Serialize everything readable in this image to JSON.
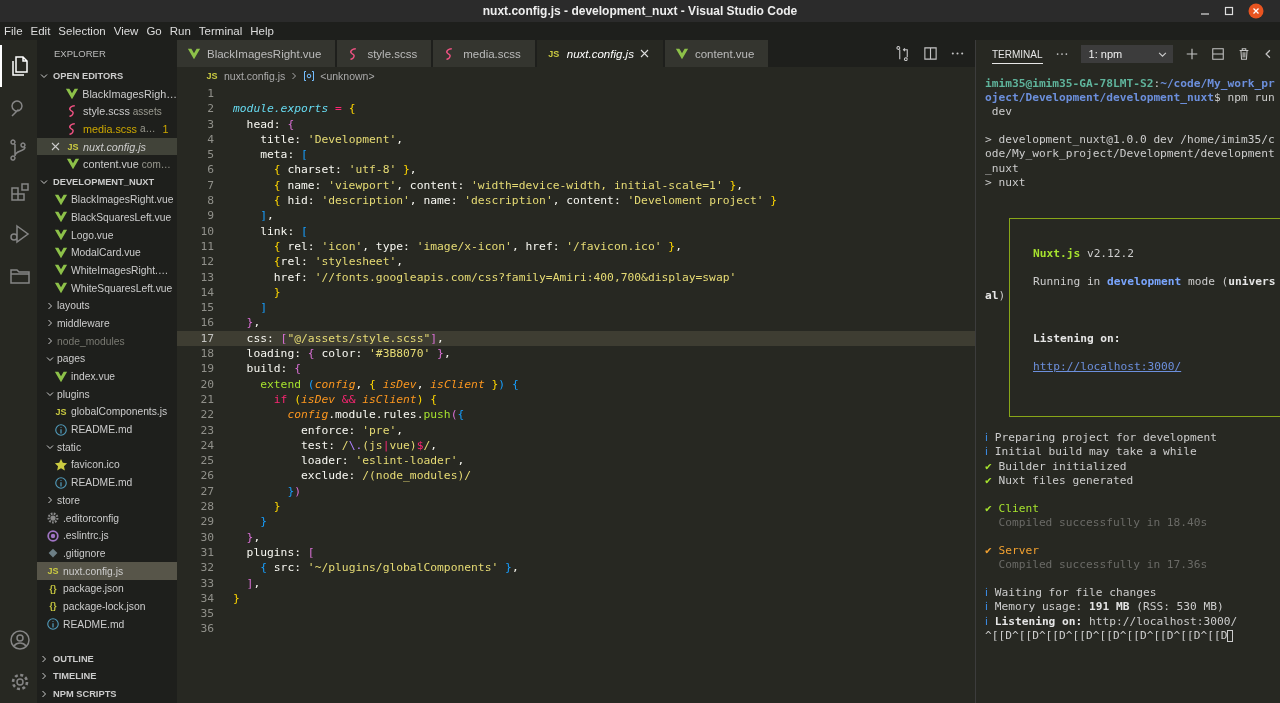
{
  "window": {
    "title": "nuxt.config.js - development_nuxt - Visual Studio Code"
  },
  "menu": [
    "File",
    "Edit",
    "Selection",
    "View",
    "Go",
    "Run",
    "Terminal",
    "Help"
  ],
  "activity_bar": [
    {
      "kind": "files",
      "selected": true
    },
    {
      "kind": "search",
      "selected": false
    },
    {
      "kind": "branch",
      "selected": false
    },
    {
      "kind": "blocks",
      "selected": false
    },
    {
      "kind": "run",
      "selected": false
    },
    {
      "kind": "folder",
      "selected": false
    }
  ],
  "activity_bar_bottom": [
    {
      "kind": "account"
    },
    {
      "kind": "settings"
    }
  ],
  "explorer": {
    "title": "EXPLORER",
    "open_editors": {
      "label": "OPEN EDITORS",
      "expanded": true,
      "items": [
        {
          "name": "BlackImagesRigh…",
          "kind": "vue",
          "selected": false,
          "warning": false,
          "preview": false
        },
        {
          "name": "style.scss",
          "description": "assets",
          "kind": "scss",
          "selected": false,
          "warning": false,
          "preview": false
        },
        {
          "name": "media.scss",
          "description": "a…",
          "badge": "1",
          "kind": "scss",
          "selected": false,
          "warning": true,
          "preview": false
        },
        {
          "name": "nuxt.config.js",
          "kind": "glyph",
          "glyph": "JS",
          "selected": true,
          "warning": false,
          "preview": true
        },
        {
          "name": "content.vue",
          "description": "com…",
          "kind": "vue",
          "selected": false,
          "warning": false,
          "preview": false
        }
      ]
    },
    "project": {
      "label": "DEVELOPMENT_NUXT",
      "expanded": true,
      "tree": [
        {
          "kind": "group",
          "children": [
            {
              "kind": "vue",
              "name": "BlackImagesRight.vue",
              "selected": false,
              "ignored": false
            },
            {
              "kind": "vue",
              "name": "BlackSquaresLeft.vue",
              "selected": false,
              "ignored": false
            },
            {
              "kind": "vue",
              "name": "Logo.vue",
              "selected": false,
              "ignored": false
            },
            {
              "kind": "vue",
              "name": "ModalCard.vue",
              "selected": false,
              "ignored": false
            },
            {
              "kind": "vue",
              "name": "WhiteImagesRight.…",
              "selected": false,
              "ignored": false
            },
            {
              "kind": "vue",
              "name": "WhiteSquaresLeft.vue",
              "selected": false,
              "ignored": false
            }
          ]
        },
        {
          "kind": "folder",
          "name": "layouts",
          "expanded": false,
          "selected": false,
          "ignored": false
        },
        {
          "kind": "folder",
          "name": "middleware",
          "expanded": false,
          "selected": false,
          "ignored": false
        },
        {
          "kind": "folder",
          "name": "node_modules",
          "expanded": false,
          "selected": false,
          "ignored": true
        },
        {
          "kind": "folder",
          "name": "pages",
          "expanded": true,
          "selected": false,
          "ignored": false,
          "children": [
            {
              "kind": "vue",
              "name": "index.vue",
              "selected": false,
              "ignored": false
            }
          ]
        },
        {
          "kind": "folder",
          "name": "plugins",
          "expanded": true,
          "selected": false,
          "ignored": false,
          "children": [
            {
              "kind": "glyph",
              "glyph": "JS",
              "name": "globalComponents.js",
              "selected": false,
              "ignored": false
            },
            {
              "kind": "info",
              "name": "README.md",
              "selected": false,
              "ignored": false
            }
          ]
        },
        {
          "kind": "folder",
          "name": "static",
          "expanded": true,
          "selected": false,
          "ignored": false,
          "children": [
            {
              "kind": "star",
              "name": "favicon.ico",
              "selected": false,
              "ignored": false
            },
            {
              "kind": "info",
              "name": "README.md",
              "selected": false,
              "ignored": false
            }
          ]
        },
        {
          "kind": "folder",
          "name": "store",
          "expanded": false,
          "selected": false,
          "ignored": false
        },
        {
          "kind": "gear",
          "name": ".editorconfig",
          "selected": false,
          "ignored": false
        },
        {
          "kind": "ring",
          "name": ".eslintrc.js",
          "selected": false,
          "ignored": false
        },
        {
          "kind": "diamond",
          "name": ".gitignore",
          "selected": false,
          "ignored": false
        },
        {
          "kind": "glyph",
          "glyph": "JS",
          "name": "nuxt.config.js",
          "selected": true,
          "ignored": false
        },
        {
          "kind": "glyph",
          "glyph": "{}",
          "name": "package.json",
          "selected": false,
          "ignored": false
        },
        {
          "kind": "glyph",
          "glyph": "{}",
          "name": "package-lock.json",
          "selected": false,
          "ignored": false
        },
        {
          "kind": "info",
          "name": "README.md",
          "selected": false,
          "ignored": false
        }
      ]
    },
    "collapsed_sections": [
      {
        "label": "OUTLINE",
        "expanded": false
      },
      {
        "label": "TIMELINE",
        "expanded": false
      },
      {
        "label": "NPM SCRIPTS",
        "expanded": false
      }
    ]
  },
  "tabs": [
    {
      "label": "BlackImagesRight.vue",
      "kind": "vue",
      "selected": false,
      "preview": false
    },
    {
      "label": "style.scss",
      "kind": "scss",
      "selected": false,
      "preview": false
    },
    {
      "label": "media.scss",
      "kind": "scss",
      "selected": false,
      "preview": false
    },
    {
      "label": "nuxt.config.js",
      "kind": "glyph",
      "glyph": "JS",
      "selected": true,
      "preview": true
    },
    {
      "label": "content.vue",
      "kind": "vue",
      "selected": false,
      "preview": false
    }
  ],
  "breadcrumb": {
    "kind": "glyph",
    "glyph": "JS",
    "file": "nuxt.config.js",
    "symbol": "<unknown>"
  },
  "editor": {
    "lines": [
      {
        "n": "1",
        "current": false
      },
      {
        "n": "2",
        "current": false,
        "tokens": [
          {
            "kind": "builtin",
            "t": "module.exports"
          },
          {
            "kind": "operator",
            "t": " = "
          },
          {
            "kind": "bracket1",
            "t": "{"
          }
        ]
      },
      {
        "n": "3",
        "current": false,
        "tokens": [
          {
            "kind": "plain",
            "t": "  head: "
          },
          {
            "kind": "bracket2",
            "t": "{"
          }
        ]
      },
      {
        "n": "4",
        "current": false,
        "tokens": [
          {
            "kind": "plain",
            "t": "    title: "
          },
          {
            "kind": "string",
            "t": "'Development'"
          },
          {
            "kind": "plain",
            "t": ","
          }
        ]
      },
      {
        "n": "5",
        "current": false,
        "tokens": [
          {
            "kind": "plain",
            "t": "    meta: "
          },
          {
            "kind": "bracket3",
            "t": "["
          }
        ]
      },
      {
        "n": "6",
        "current": false,
        "tokens": [
          {
            "kind": "bracket1",
            "t": "      {"
          },
          {
            "kind": "plain",
            "t": " charset: "
          },
          {
            "kind": "string",
            "t": "'utf-8'"
          },
          {
            "kind": "bracket1",
            "t": " }"
          },
          {
            "kind": "plain",
            "t": ","
          }
        ]
      },
      {
        "n": "7",
        "current": false,
        "tokens": [
          {
            "kind": "bracket1",
            "t": "      {"
          },
          {
            "kind": "plain",
            "t": " name: "
          },
          {
            "kind": "string",
            "t": "'viewport'"
          },
          {
            "kind": "plain",
            "t": ", content: "
          },
          {
            "kind": "string",
            "t": "'width=device-width, initial-scale=1'"
          },
          {
            "kind": "bracket1",
            "t": " }"
          },
          {
            "kind": "plain",
            "t": ","
          }
        ]
      },
      {
        "n": "8",
        "current": false,
        "tokens": [
          {
            "kind": "bracket1",
            "t": "      {"
          },
          {
            "kind": "plain",
            "t": " hid: "
          },
          {
            "kind": "string",
            "t": "'description'"
          },
          {
            "kind": "plain",
            "t": ", name: "
          },
          {
            "kind": "string",
            "t": "'description'"
          },
          {
            "kind": "plain",
            "t": ", content: "
          },
          {
            "kind": "string",
            "t": "'Develoment project'"
          },
          {
            "kind": "bracket1",
            "t": " }"
          }
        ]
      },
      {
        "n": "9",
        "current": false,
        "tokens": [
          {
            "kind": "bracket3",
            "t": "    ]"
          },
          {
            "kind": "plain",
            "t": ","
          }
        ]
      },
      {
        "n": "10",
        "current": false,
        "tokens": [
          {
            "kind": "plain",
            "t": "    link: "
          },
          {
            "kind": "bracket3",
            "t": "["
          }
        ]
      },
      {
        "n": "11",
        "current": false,
        "tokens": [
          {
            "kind": "bracket1",
            "t": "      {"
          },
          {
            "kind": "plain",
            "t": " rel: "
          },
          {
            "kind": "string",
            "t": "'icon'"
          },
          {
            "kind": "plain",
            "t": ", type: "
          },
          {
            "kind": "string",
            "t": "'image/x-icon'"
          },
          {
            "kind": "plain",
            "t": ", href: "
          },
          {
            "kind": "string",
            "t": "'/favicon.ico'"
          },
          {
            "kind": "bracket1",
            "t": " }"
          },
          {
            "kind": "plain",
            "t": ","
          }
        ]
      },
      {
        "n": "12",
        "current": false,
        "tokens": [
          {
            "kind": "bracket1",
            "t": "      {"
          },
          {
            "kind": "plain",
            "t": "rel: "
          },
          {
            "kind": "string",
            "t": "'stylesheet'"
          },
          {
            "kind": "plain",
            "t": ","
          }
        ]
      },
      {
        "n": "13",
        "current": false,
        "tokens": [
          {
            "kind": "plain",
            "t": "      href: "
          },
          {
            "kind": "string",
            "t": "'//fonts.googleapis.com/css?family=Amiri:400,700&display=swap'"
          }
        ]
      },
      {
        "n": "14",
        "current": false,
        "tokens": [
          {
            "kind": "bracket1",
            "t": "      }"
          }
        ]
      },
      {
        "n": "15",
        "current": false,
        "tokens": [
          {
            "kind": "bracket3",
            "t": "    ]"
          }
        ]
      },
      {
        "n": "16",
        "current": false,
        "tokens": [
          {
            "kind": "bracket2",
            "t": "  }"
          },
          {
            "kind": "plain",
            "t": ","
          }
        ]
      },
      {
        "n": "17",
        "current": true,
        "tokens": [
          {
            "kind": "plain",
            "t": "  css: "
          },
          {
            "kind": "bracket2",
            "t": "["
          },
          {
            "kind": "string",
            "t": "\"@/assets/style.scss\""
          },
          {
            "kind": "bracket2",
            "t": "]"
          },
          {
            "kind": "plain",
            "t": ","
          }
        ]
      },
      {
        "n": "18",
        "current": false,
        "tokens": [
          {
            "kind": "plain",
            "t": "  loading: "
          },
          {
            "kind": "bracket2",
            "t": "{"
          },
          {
            "kind": "plain",
            "t": " color: "
          },
          {
            "kind": "string",
            "t": "'#3B8070'"
          },
          {
            "kind": "bracket2",
            "t": " }"
          },
          {
            "kind": "plain",
            "t": ","
          }
        ]
      },
      {
        "n": "19",
        "current": false,
        "tokens": [
          {
            "kind": "plain",
            "t": "  build: "
          },
          {
            "kind": "bracket2",
            "t": "{"
          }
        ]
      },
      {
        "n": "20",
        "current": false,
        "tokens": [
          {
            "kind": "function",
            "t": "    extend"
          },
          {
            "kind": "bracket3",
            "t": " ("
          },
          {
            "kind": "param",
            "t": "config"
          },
          {
            "kind": "plain",
            "t": ", "
          },
          {
            "kind": "bracket1",
            "t": "{"
          },
          {
            "kind": "param",
            "t": " isDev"
          },
          {
            "kind": "plain",
            "t": ", "
          },
          {
            "kind": "param",
            "t": "isClient"
          },
          {
            "kind": "bracket1",
            "t": " }"
          },
          {
            "kind": "bracket3",
            "t": ") {"
          }
        ]
      },
      {
        "n": "21",
        "current": false,
        "tokens": [
          {
            "kind": "keyword",
            "t": "      if"
          },
          {
            "kind": "bracket1",
            "t": " ("
          },
          {
            "kind": "param",
            "t": "isDev"
          },
          {
            "kind": "keyword",
            "t": " &&"
          },
          {
            "kind": "param",
            "t": " isClient"
          },
          {
            "kind": "bracket1",
            "t": ") {"
          }
        ]
      },
      {
        "n": "22",
        "current": false,
        "tokens": [
          {
            "kind": "param",
            "t": "        config"
          },
          {
            "kind": "plain",
            "t": ".module.rules."
          },
          {
            "kind": "function",
            "t": "push"
          },
          {
            "kind": "bracket2",
            "t": "("
          },
          {
            "kind": "bracket3",
            "t": "{"
          }
        ]
      },
      {
        "n": "23",
        "current": false,
        "tokens": [
          {
            "kind": "plain",
            "t": "          enforce: "
          },
          {
            "kind": "string",
            "t": "'pre'"
          },
          {
            "kind": "plain",
            "t": ","
          }
        ]
      },
      {
        "n": "24",
        "current": false,
        "tokens": [
          {
            "kind": "plain",
            "t": "          test: "
          },
          {
            "kind": "string",
            "t": "/"
          },
          {
            "kind": "escape",
            "t": "\\."
          },
          {
            "kind": "string",
            "t": "(js"
          },
          {
            "kind": "keyword",
            "t": "|"
          },
          {
            "kind": "string",
            "t": "vue)"
          },
          {
            "kind": "keyword",
            "t": "$"
          },
          {
            "kind": "string",
            "t": "/"
          },
          {
            "kind": "plain",
            "t": ","
          }
        ]
      },
      {
        "n": "25",
        "current": false,
        "tokens": [
          {
            "kind": "plain",
            "t": "          loader: "
          },
          {
            "kind": "string",
            "t": "'eslint-loader'"
          },
          {
            "kind": "plain",
            "t": ","
          }
        ]
      },
      {
        "n": "26",
        "current": false,
        "tokens": [
          {
            "kind": "plain",
            "t": "          exclude: "
          },
          {
            "kind": "string",
            "t": "/(node_modules)/"
          }
        ]
      },
      {
        "n": "27",
        "current": false,
        "tokens": [
          {
            "kind": "bracket3",
            "t": "        }"
          },
          {
            "kind": "bracket2",
            "t": ")"
          }
        ]
      },
      {
        "n": "28",
        "current": false,
        "tokens": [
          {
            "kind": "bracket1",
            "t": "      }"
          }
        ]
      },
      {
        "n": "29",
        "current": false,
        "tokens": [
          {
            "kind": "bracket3",
            "t": "    }"
          }
        ]
      },
      {
        "n": "30",
        "current": false,
        "tokens": [
          {
            "kind": "bracket2",
            "t": "  }"
          },
          {
            "kind": "plain",
            "t": ","
          }
        ]
      },
      {
        "n": "31",
        "current": false,
        "tokens": [
          {
            "kind": "plain",
            "t": "  plugins: "
          },
          {
            "kind": "bracket2",
            "t": "["
          }
        ]
      },
      {
        "n": "32",
        "current": false,
        "tokens": [
          {
            "kind": "bracket3",
            "t": "    {"
          },
          {
            "kind": "plain",
            "t": " src: "
          },
          {
            "kind": "string",
            "t": "'~/plugins/globalComponents'"
          },
          {
            "kind": "bracket3",
            "t": " }"
          },
          {
            "kind": "plain",
            "t": ","
          }
        ]
      },
      {
        "n": "33",
        "current": false,
        "tokens": [
          {
            "kind": "bracket2",
            "t": "  ]"
          },
          {
            "kind": "plain",
            "t": ","
          }
        ]
      },
      {
        "n": "34",
        "current": false,
        "tokens": [
          {
            "kind": "bracket1",
            "t": "}"
          }
        ]
      },
      {
        "n": "35",
        "current": false
      },
      {
        "n": "36",
        "current": false
      }
    ]
  },
  "terminal": {
    "tab": "TERMINAL",
    "dropdown": "1: npm",
    "lines": [
      {
        "kind": "text",
        "tokens": [
          {
            "kind": "user",
            "t": "imim35@imim35-GA-78LMT-S2"
          },
          {
            "kind": "plain",
            "t": ":"
          },
          {
            "kind": "path",
            "t": "~/code/My_work_pr"
          }
        ]
      },
      {
        "kind": "text",
        "tokens": [
          {
            "kind": "path",
            "t": "oject/Development/development_nuxt"
          },
          {
            "kind": "plain",
            "t": "$ npm run"
          }
        ]
      },
      {
        "kind": "text",
        "tokens": [
          {
            "kind": "plain",
            "t": " dev"
          }
        ]
      },
      {
        "kind": "blank"
      },
      {
        "kind": "text",
        "tokens": [
          {
            "kind": "plain",
            "t": "> development_nuxt@1.0.0 dev /home/imim35/c"
          }
        ]
      },
      {
        "kind": "text",
        "tokens": [
          {
            "kind": "plain",
            "t": "ode/My_work_project/Development/development"
          }
        ]
      },
      {
        "kind": "text",
        "tokens": [
          {
            "kind": "plain",
            "t": "_nuxt"
          }
        ]
      },
      {
        "kind": "text",
        "tokens": [
          {
            "kind": "plain",
            "t": "> nuxt"
          }
        ]
      },
      {
        "kind": "blank"
      },
      {
        "kind": "blank"
      }
    ],
    "banner": [
      {
        "kind": "blank"
      },
      {
        "kind": "blank"
      },
      {
        "kind": "text",
        "tokens": [
          {
            "kind": "accent",
            "t": "Nuxt.js"
          },
          {
            "kind": "plain",
            "t": " v2.12.2"
          }
        ]
      },
      {
        "kind": "blank"
      },
      {
        "kind": "text",
        "tokens": [
          {
            "kind": "plain",
            "t": "Running in "
          },
          {
            "kind": "highlight",
            "t": "development"
          },
          {
            "kind": "plain",
            "t": " mode ("
          },
          {
            "kind": "bold",
            "t": "univers"
          }
        ]
      },
      {
        "kind": "wrap",
        "tokens": [
          {
            "kind": "bold",
            "t": "al"
          },
          {
            "kind": "plain",
            "t": ")"
          }
        ]
      },
      {
        "kind": "blank"
      },
      {
        "kind": "blank"
      },
      {
        "kind": "text",
        "tokens": [
          {
            "kind": "bold",
            "t": "Listening on:"
          }
        ]
      },
      {
        "kind": "blank"
      },
      {
        "kind": "text",
        "tokens": [
          {
            "kind": "link",
            "t": "http://localhost:3000/"
          }
        ]
      },
      {
        "kind": "blank"
      },
      {
        "kind": "blank"
      },
      {
        "kind": "blank"
      }
    ],
    "lines_after": [
      {
        "kind": "blank"
      },
      {
        "kind": "text",
        "tokens": [
          {
            "kind": "info",
            "t": "ℹ"
          },
          {
            "kind": "plain",
            "t": " Preparing project for development"
          }
        ]
      },
      {
        "kind": "text",
        "tokens": [
          {
            "kind": "info",
            "t": "ℹ"
          },
          {
            "kind": "plain",
            "t": " Initial build may take a while"
          }
        ]
      },
      {
        "kind": "text",
        "tokens": [
          {
            "kind": "ok",
            "t": "✔"
          },
          {
            "kind": "plain",
            "t": " Builder initialized"
          }
        ]
      },
      {
        "kind": "text",
        "tokens": [
          {
            "kind": "ok",
            "t": "✔"
          },
          {
            "kind": "plain",
            "t": " Nuxt files generated"
          }
        ]
      },
      {
        "kind": "blank"
      },
      {
        "kind": "text",
        "tokens": [
          {
            "kind": "ok",
            "t": "✔ Client"
          }
        ]
      },
      {
        "kind": "text",
        "tokens": [
          {
            "kind": "dim",
            "t": "  Compiled successfully in 18.40s"
          }
        ]
      },
      {
        "kind": "blank"
      },
      {
        "kind": "text",
        "tokens": [
          {
            "kind": "warn",
            "t": "✔ Server"
          }
        ]
      },
      {
        "kind": "text",
        "tokens": [
          {
            "kind": "dim",
            "t": "  Compiled successfully in 17.36s"
          }
        ]
      },
      {
        "kind": "blank"
      },
      {
        "kind": "text",
        "tokens": [
          {
            "kind": "info",
            "t": "ℹ"
          },
          {
            "kind": "plain",
            "t": " Waiting for file changes"
          }
        ]
      },
      {
        "kind": "text",
        "tokens": [
          {
            "kind": "info",
            "t": "ℹ"
          },
          {
            "kind": "plain",
            "t": " Memory usage: "
          },
          {
            "kind": "bold",
            "t": "191 MB"
          },
          {
            "kind": "plain",
            "t": " (RSS: 530 MB)"
          }
        ]
      },
      {
        "kind": "text",
        "tokens": [
          {
            "kind": "info",
            "t": "ℹ"
          },
          {
            "kind": "bold",
            "t": " Listening on:"
          },
          {
            "kind": "plain",
            "t": " http://localhost:3000/"
          }
        ]
      },
      {
        "kind": "prompt",
        "tokens": [
          {
            "kind": "plain",
            "t": "^[[D^[[D^[[D^[[D^[[D^[[D^[[D^[[D^[[D"
          }
        ]
      }
    ]
  }
}
